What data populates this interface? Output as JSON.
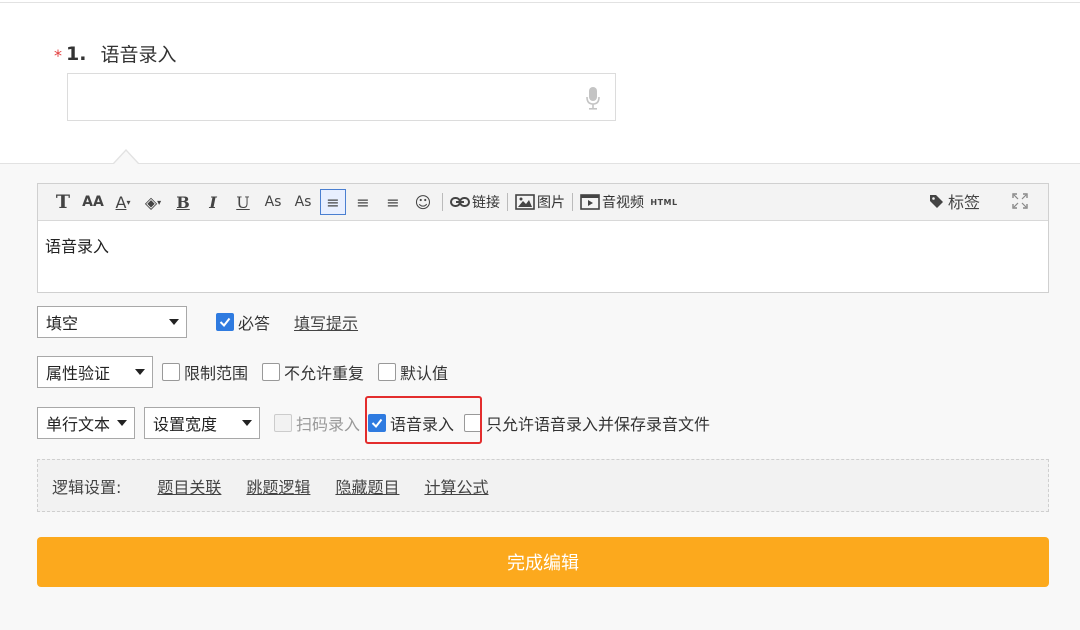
{
  "question": {
    "required_mark": "*",
    "number": "1.",
    "title": "语音录入"
  },
  "editor": {
    "toolbar": {
      "bold_t": "T",
      "font_size": "AA",
      "font_color": "A",
      "bg_color": "◈",
      "bold": "B",
      "italic": "I",
      "underline": "U",
      "subscript": "As",
      "superscript": "As",
      "align_left": "≡",
      "align_center": "≡",
      "align_right": "≡",
      "emoji": "☺",
      "link_label": "链接",
      "image_label": "图片",
      "video_label": "音视频",
      "html_label": "HTML",
      "tag_label": "标签"
    },
    "content": "语音录入"
  },
  "row1": {
    "type_select": "填空",
    "required_label": "必答",
    "required_checked": true,
    "hint_link": "填写提示"
  },
  "row2": {
    "validation_select": "属性验证",
    "limit_range": "限制范围",
    "no_duplicate": "不允许重复",
    "default_value": "默认值"
  },
  "row3": {
    "text_type_select": "单行文本",
    "width_select": "设置宽度",
    "scan_input": "扫码录入",
    "voice_input": "语音录入",
    "voice_input_checked": true,
    "voice_only": "只允许语音录入并保存录音文件"
  },
  "logic": {
    "label": "逻辑设置:",
    "links": [
      "题目关联",
      "跳题逻辑",
      "隐藏题目",
      "计算公式"
    ]
  },
  "done_button": "完成编辑",
  "colors": {
    "accent": "#fca91d",
    "checkbox": "#2f7be0",
    "highlight": "#e32d2d",
    "required": "#e23c3c"
  }
}
